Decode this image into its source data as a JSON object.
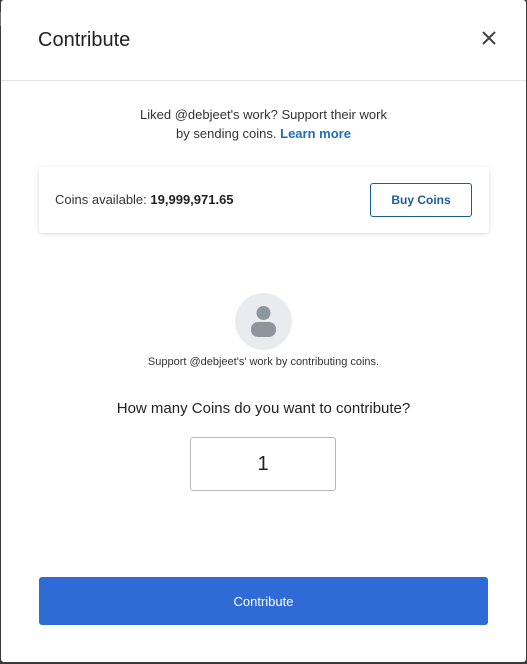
{
  "dialog": {
    "title": "Contribute",
    "close_icon": "close-icon"
  },
  "intro": {
    "line1": "Liked @debjeet's work? Support their work",
    "line2_prefix": "by sending coins.",
    "learn_more": "Learn more"
  },
  "coins": {
    "label": "Coins available:",
    "value": "19,999,971.65",
    "buy_button": "Buy Coins"
  },
  "profile": {
    "avatar_icon": "user-avatar-icon",
    "support_text": "Support @debjeet's' work by contributing coins."
  },
  "form": {
    "question": "How many Coins do you want to contribute?",
    "amount": "1"
  },
  "actions": {
    "contribute_button": "Contribute"
  },
  "colors": {
    "primary": "#2e6bd6",
    "link": "#1e6fb8",
    "outline_button": "#1d5c99"
  }
}
